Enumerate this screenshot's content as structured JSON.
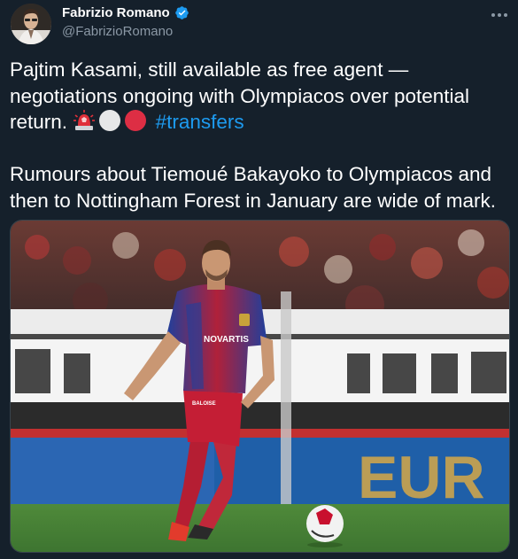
{
  "author": {
    "display_name": "Fabrizio Romano",
    "handle": "@FabrizioRomano",
    "verified": true
  },
  "tweet": {
    "paragraph1": "Pajtim Kasami, still available as free agent — negotiations ongoing with Olympiacos over potential return.",
    "hashtag": "#transfers",
    "paragraph2": "Rumours about Tiemoué Bakayoko to Olympiacos and then to Nottingham Forest in January are wide of mark.",
    "emojis": [
      "police-light-icon",
      "white-circle-icon",
      "red-circle-icon"
    ]
  },
  "photo": {
    "shirt_sponsor": "NOVARTIS",
    "shorts_sponsor": "BALOISE",
    "ad_board_text": "EUR"
  },
  "colors": {
    "background": "#15202b",
    "text": "#ffffff",
    "secondary_text": "#8b98a5",
    "link": "#1d9bf0",
    "verified": "#1d9bf0",
    "jersey_blue": "#1f3f9c",
    "jersey_red": "#c8102e"
  }
}
